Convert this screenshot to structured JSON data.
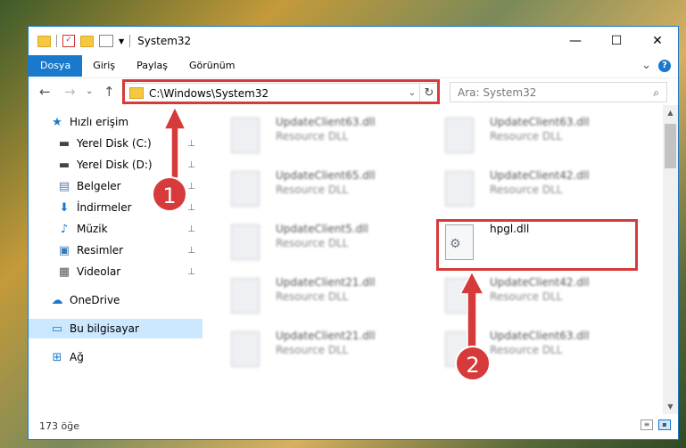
{
  "window": {
    "title": "System32",
    "controls": {
      "minimize": "—",
      "maximize": "☐",
      "close": "✕"
    }
  },
  "ribbon": {
    "tabs": [
      "Dosya",
      "Giriş",
      "Paylaş",
      "Görünüm"
    ],
    "expand_glyph": "⌄",
    "help_glyph": "?"
  },
  "nav": {
    "back": "←",
    "forward": "→",
    "dropdown": "⌄",
    "up": "↑"
  },
  "address": {
    "path": "C:\\Windows\\System32",
    "chevron": "⌄",
    "refresh": "↻"
  },
  "search": {
    "placeholder": "Ara: System32",
    "icon": "⌕"
  },
  "sidebar": {
    "quick_access": "Hızlı erişim",
    "items": [
      {
        "label": "Yerel Disk (C:)",
        "icon": "drive-icon",
        "pinned": true
      },
      {
        "label": "Yerel Disk (D:)",
        "icon": "drive-icon",
        "pinned": true
      },
      {
        "label": "Belgeler",
        "icon": "documents-icon",
        "pinned": true
      },
      {
        "label": "İndirmeler",
        "icon": "download-icon",
        "pinned": true
      },
      {
        "label": "Müzik",
        "icon": "music-icon",
        "pinned": true
      },
      {
        "label": "Resimler",
        "icon": "pictures-icon",
        "pinned": true
      },
      {
        "label": "Videolar",
        "icon": "videos-icon",
        "pinned": true
      }
    ],
    "onedrive": "OneDrive",
    "this_pc": "Bu bilgisayar",
    "network": "Ağ",
    "pin_glyph": "📌"
  },
  "files": [
    {
      "name": "UpdateClient63.dll",
      "type": "Resource DLL"
    },
    {
      "name": "UpdateClient63.dll",
      "type": "Resource DLL"
    },
    {
      "name": "UpdateClient65.dll",
      "type": "Resource DLL"
    },
    {
      "name": "UpdateClient42.dll",
      "type": "Resource DLL"
    },
    {
      "name": "UpdateClient5.dll",
      "type": "Resource DLL"
    },
    {
      "name": "hpgl.dll",
      "type": ""
    },
    {
      "name": "UpdateClient21.dll",
      "type": "Resource DLL"
    },
    {
      "name": "UpdateClient42.dll",
      "type": "Resource DLL"
    },
    {
      "name": "UpdateClient21.dll",
      "type": "Resource DLL"
    },
    {
      "name": "UpdateClient63.dll",
      "type": "Resource DLL"
    }
  ],
  "status": {
    "item_count": "173 öğe"
  },
  "annotations": {
    "step1": "1",
    "step2": "2",
    "color": "#d63a3a"
  }
}
